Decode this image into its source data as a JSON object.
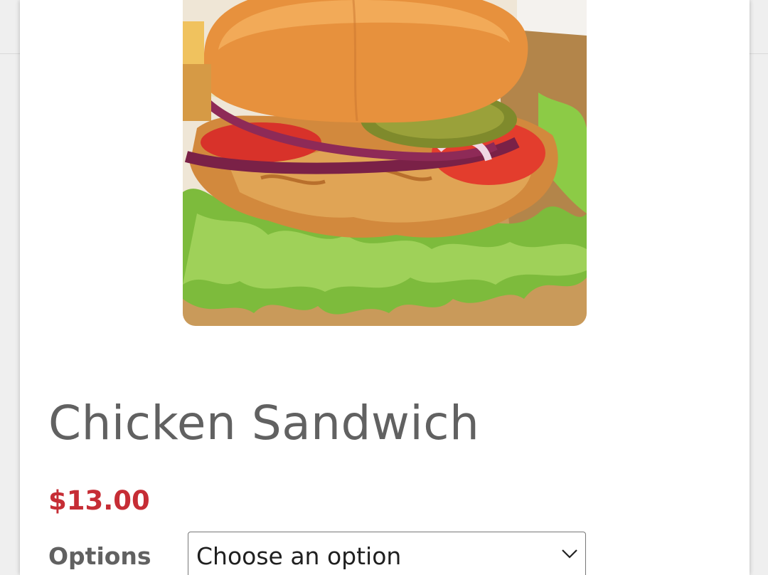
{
  "product": {
    "image_alt": "Chicken Sandwich",
    "title": "Chicken Sandwich",
    "price": "$13.00"
  },
  "options": {
    "label": "Options",
    "selected": "Choose an option",
    "icon": "chevron-down-icon"
  },
  "colors": {
    "price": "#c62d35",
    "title": "#616161",
    "background": "#ffffff"
  }
}
